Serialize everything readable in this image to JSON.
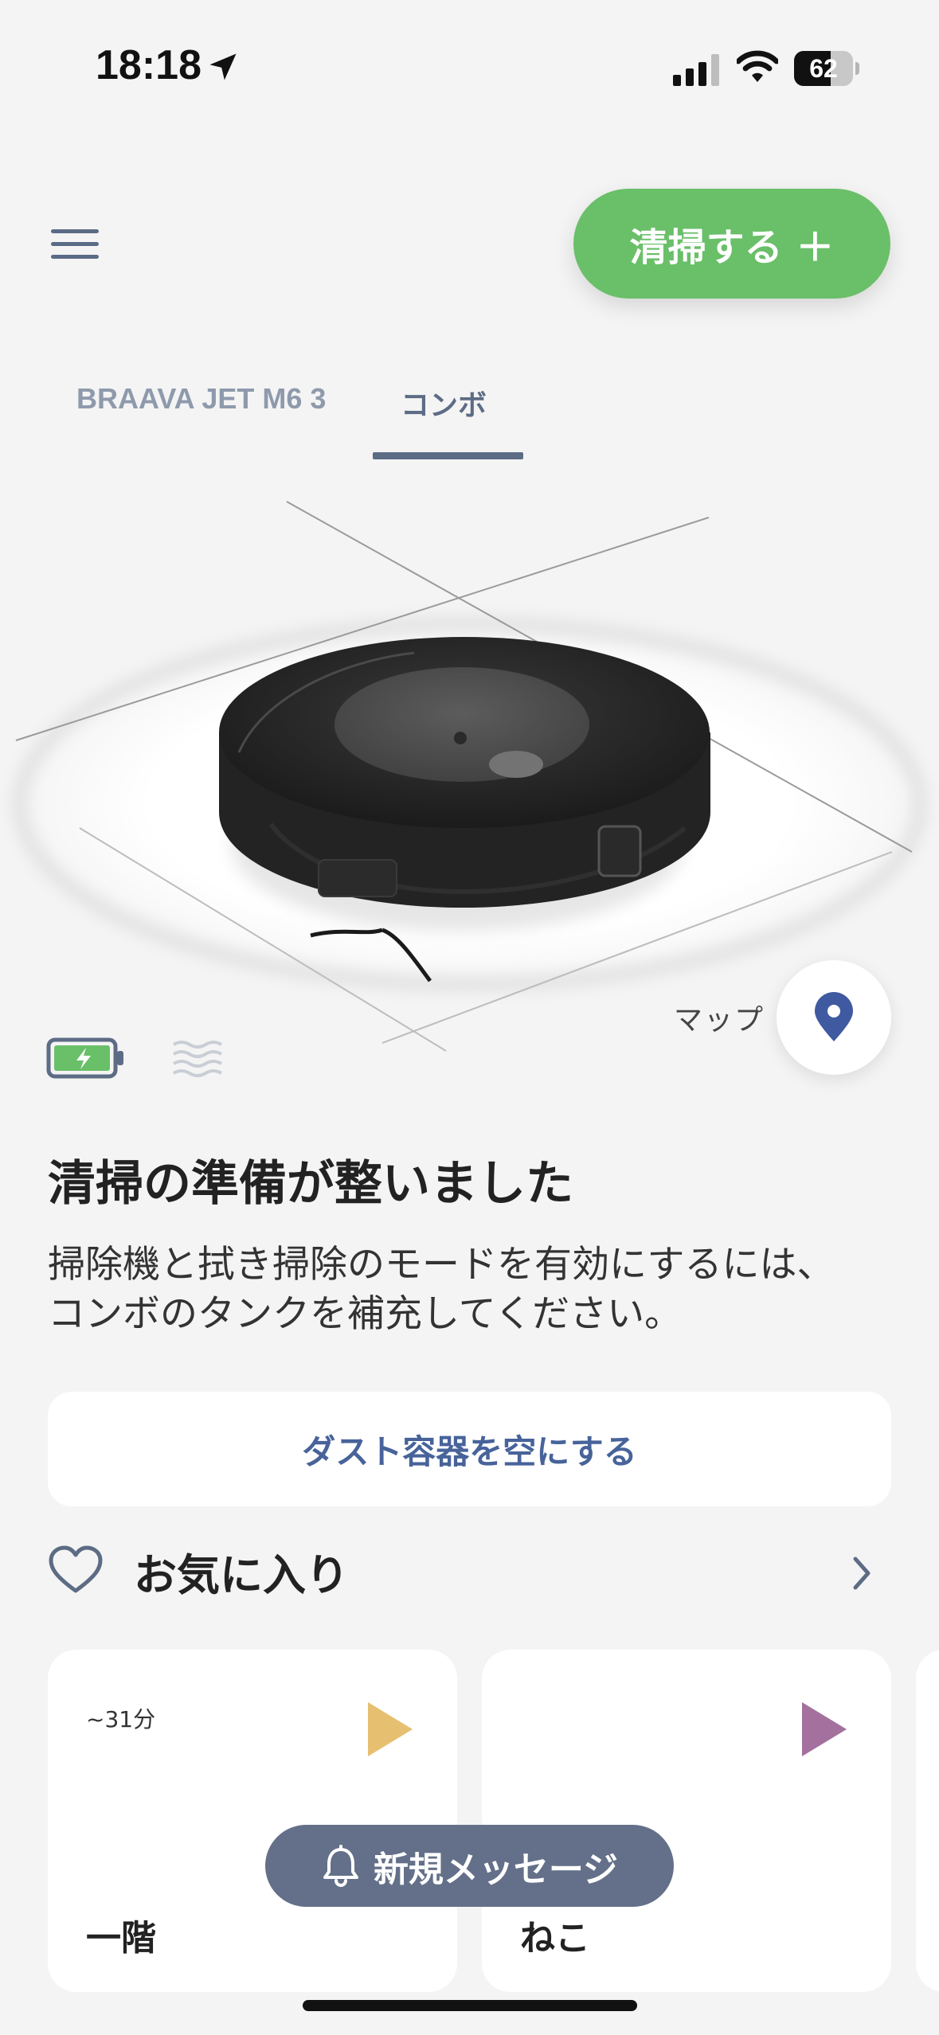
{
  "status_bar": {
    "time": "18:18",
    "battery_percent": 62,
    "battery_label": "62"
  },
  "header": {
    "clean_button_label": "清掃する ＋"
  },
  "tabs": [
    {
      "label": "BRAAVA JET M6 3",
      "selected": false
    },
    {
      "label": "コンボ",
      "selected": true
    }
  ],
  "robot_status": {
    "map_label": "マップ",
    "headline": "清掃の準備が整いました",
    "description": "掃除機と拭き掃除のモードを有効にするには、コンボのタンクを補充してください。",
    "dust_button_label": "ダスト容器を空にする"
  },
  "favorites": {
    "title": "お気に入り",
    "items": [
      {
        "duration": "~31分",
        "name": "一階",
        "play_color": "#e6c070"
      },
      {
        "duration": "",
        "name": "ねこ",
        "play_color": "#a4709e"
      }
    ]
  },
  "notification": {
    "label": "新規メッセージ"
  },
  "colors": {
    "primary_green": "#6abf69",
    "accent_blue": "#47639a",
    "slate": "#5d6c85"
  },
  "icons": {
    "status": [
      "location-arrow-icon",
      "cellular-signal-icon",
      "wifi-icon",
      "battery-icon"
    ],
    "main": [
      "hamburger-menu-icon",
      "battery-charging-icon",
      "water-tank-icon",
      "map-pin-icon",
      "heart-icon",
      "chevron-right-icon",
      "play-icon",
      "bell-icon"
    ]
  }
}
